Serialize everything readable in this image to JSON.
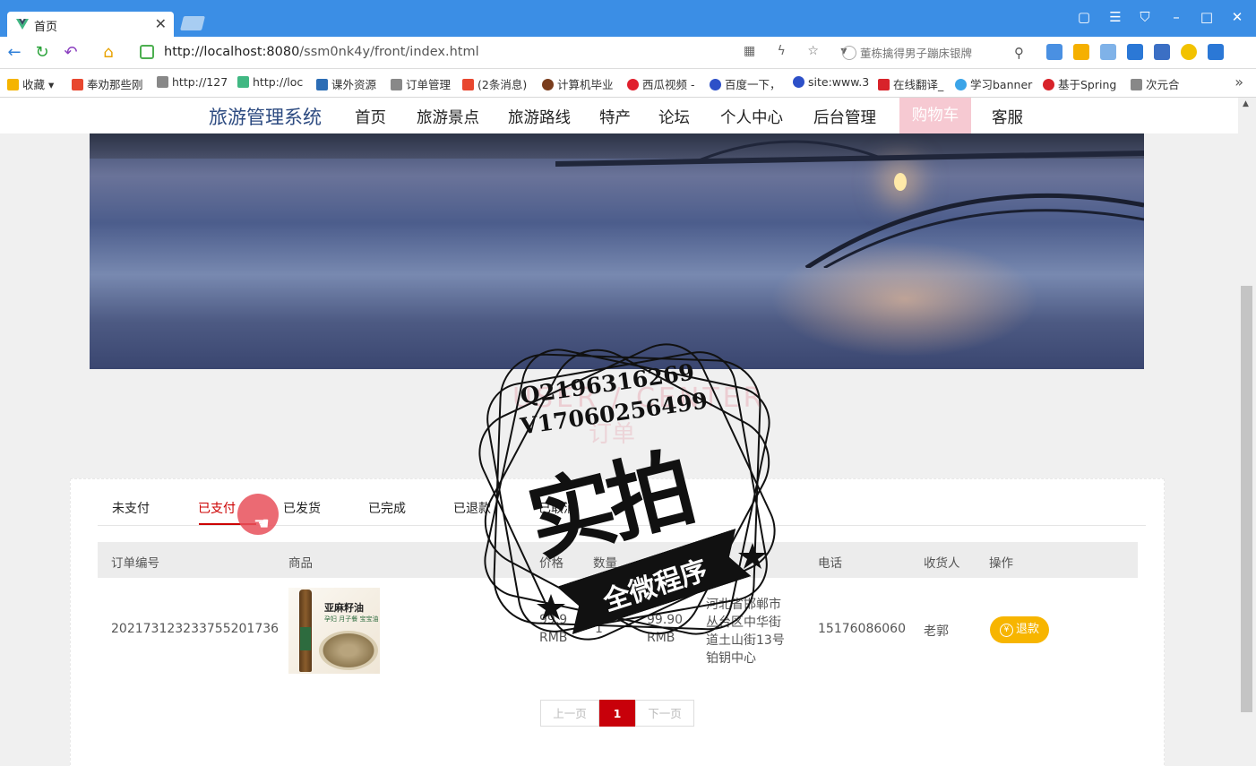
{
  "browser": {
    "tab_title": "首页",
    "tab_close": "✕",
    "url_host": "http://localhost:8080",
    "url_path": "/ssm0nk4y/front/index.html",
    "search_placeholder": "董栋擒得男子蹦床银牌",
    "bookmarks": [
      "收藏",
      "奉劝那些刚",
      "http://127",
      "http://loc",
      "课外资源",
      "订单管理",
      "(2条消息)",
      "计算机毕业",
      "西瓜视频 -",
      "百度一下，",
      "site:www.3",
      "在线翻译_",
      "学习banner",
      "基于Spring",
      "次元合"
    ],
    "bookmark_more": "»"
  },
  "site": {
    "title": "旅游管理系统",
    "nav": [
      "首页",
      "旅游景点",
      "旅游路线",
      "特产",
      "论坛",
      "个人中心",
      "后台管理"
    ],
    "cart": "购物车",
    "service": "客服"
  },
  "ghost": {
    "title": "USER / CENTER",
    "sub": "订单"
  },
  "orders": {
    "tabs": [
      "未支付",
      "已支付",
      "已发货",
      "已完成",
      "已退款",
      "已取消"
    ],
    "active_tab": "已支付",
    "headers": [
      "订单编号",
      "商品",
      "价格",
      "数量",
      "总价",
      "地址",
      "电话",
      "收货人",
      "操作"
    ],
    "row": {
      "order_no": "20217312323375520173​6",
      "product_name": "亚麻籽油",
      "product_tag": "孕妇 月子餐 宝宝油",
      "price": "99.9",
      "price_unit": "RMB",
      "qty": "1",
      "total": "99.90",
      "total_unit": "RMB",
      "address_l1": "河北省邯郸市",
      "address_l2": "丛台区中华街",
      "address_l3": "道土山街13号",
      "address_l4": "铂钥中心",
      "phone": "15176086060",
      "receiver": "老郭",
      "action": "退款",
      "action_icon": "¥"
    }
  },
  "pager": {
    "prev": "上一页",
    "current": "1",
    "next": "下一页"
  },
  "watermark": {
    "line1": "Q2196316269",
    "line2": "V17060256499",
    "big": "实拍",
    "ribbon": "全微程序"
  },
  "colors": {
    "browser_blue": "#3b8ee5",
    "site_title": "#2c4a80",
    "cart_pink": "#f6c9d2",
    "active_red": "#cc0000",
    "refund_yellow": "#f7b500"
  }
}
